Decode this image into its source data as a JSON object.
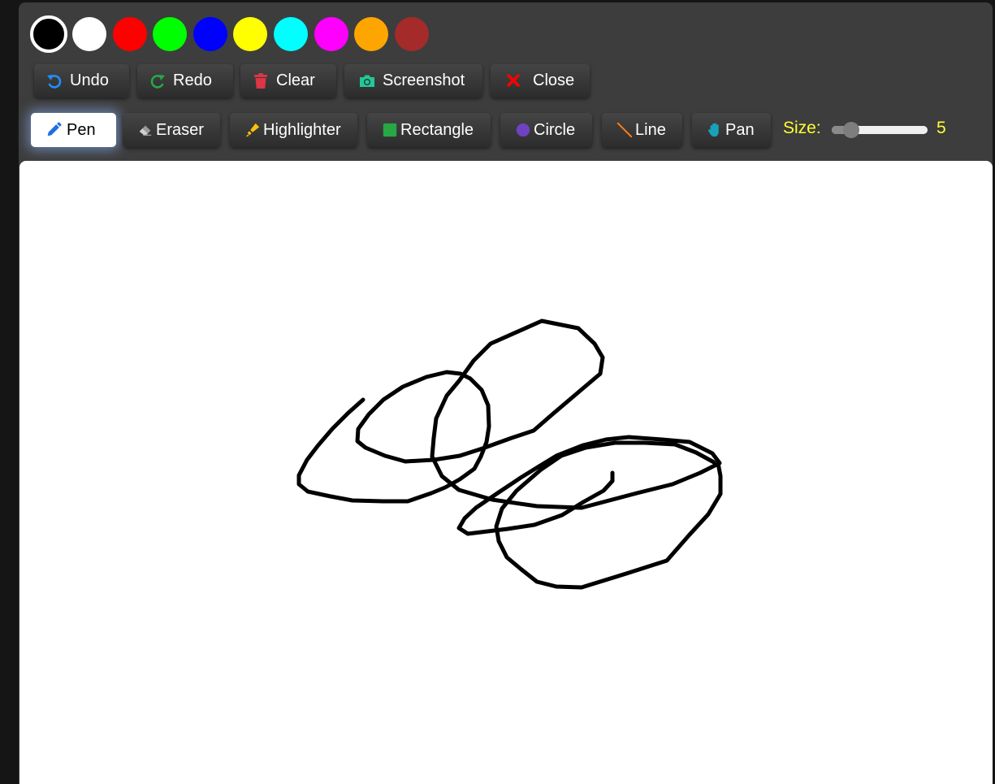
{
  "palette": {
    "colors": [
      "#000000",
      "#ffffff",
      "#ff0000",
      "#00ff00",
      "#0000ff",
      "#ffff00",
      "#00ffff",
      "#ff00ff",
      "#ffa500",
      "#a52a2a"
    ],
    "selected_index": 0
  },
  "actions": {
    "undo": {
      "label": "Undo",
      "icon": "undo-icon",
      "color": "#1e90ff"
    },
    "redo": {
      "label": "Redo",
      "icon": "redo-icon",
      "color": "#28a745"
    },
    "clear": {
      "label": "Clear",
      "icon": "trash-icon",
      "color": "#dc3545"
    },
    "screenshot": {
      "label": "Screenshot",
      "icon": "camera-icon",
      "color": "#20c997"
    },
    "close": {
      "label": "Close",
      "icon": "close-icon",
      "color": "#ff0000"
    }
  },
  "tools": {
    "pen": {
      "label": "Pen",
      "icon": "pencil-icon",
      "color": "#1e6fe0"
    },
    "eraser": {
      "label": "Eraser",
      "icon": "eraser-icon",
      "color": "#9a9a9a"
    },
    "highlighter": {
      "label": "Highlighter",
      "icon": "highlighter-icon",
      "color": "#ffc107"
    },
    "rectangle": {
      "label": "Rectangle",
      "icon": "square-icon",
      "color": "#28a745"
    },
    "circle": {
      "label": "Circle",
      "icon": "circle-icon",
      "color": "#6f42c1"
    },
    "line": {
      "label": "Line",
      "icon": "line-icon",
      "color": "#fd7e14"
    },
    "pan": {
      "label": "Pan",
      "icon": "hand-icon",
      "color": "#17a2b8"
    },
    "active": "pen"
  },
  "size": {
    "label": "Size:",
    "value": "5",
    "min": 1,
    "max": 30
  },
  "drawing": {
    "stroke_color": "#000000",
    "stroke_width": 5
  }
}
